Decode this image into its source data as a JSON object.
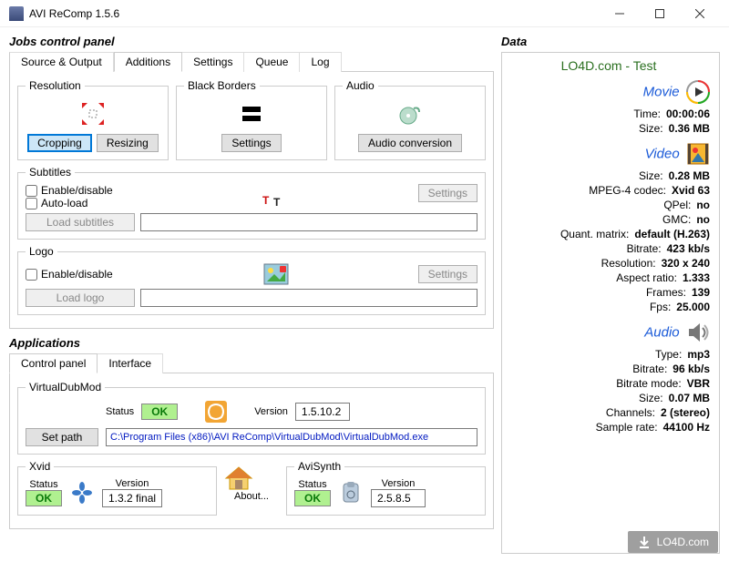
{
  "window": {
    "title": "AVI ReComp  1.5.6"
  },
  "jobs": {
    "heading": "Jobs control panel",
    "tabs": [
      "Source & Output",
      "Additions",
      "Settings",
      "Queue",
      "Log"
    ],
    "activeTab": "Additions",
    "resolution": {
      "legend": "Resolution",
      "cropping": "Cropping",
      "resizing": "Resizing",
      "icon": "resize-arrows-icon"
    },
    "blackBorders": {
      "legend": "Black Borders",
      "settings": "Settings",
      "icon": "black-borders-icon"
    },
    "audio": {
      "legend": "Audio",
      "audioConversion": "Audio conversion",
      "icon": "audio-disc-icon"
    },
    "subtitles": {
      "legend": "Subtitles",
      "enable": "Enable/disable",
      "autoload": "Auto-load",
      "load": "Load subtitles",
      "settings": "Settings",
      "icon": "font-icon"
    },
    "logo": {
      "legend": "Logo",
      "enable": "Enable/disable",
      "load": "Load logo",
      "settings": "Settings",
      "icon": "picture-icon"
    }
  },
  "apps": {
    "heading": "Applications",
    "tabs": [
      "Control panel",
      "Interface"
    ],
    "activeTab": "Control panel",
    "vdm": {
      "legend": "VirtualDubMod",
      "statusLabel": "Status",
      "status": "OK",
      "versionLabel": "Version",
      "version": "1.5.10.2",
      "setPath": "Set path",
      "path": "C:\\Program Files (x86)\\AVI ReComp\\VirtualDubMod\\VirtualDubMod.exe",
      "icon": "vdm-icon"
    },
    "xvid": {
      "legend": "Xvid",
      "statusLabel": "Status",
      "status": "OK",
      "versionLabel": "Version",
      "version": "1.3.2 final",
      "icon": "xvid-icon"
    },
    "about": {
      "label": "About...",
      "icon": "house-icon"
    },
    "avisynth": {
      "legend": "AviSynth",
      "statusLabel": "Status",
      "status": "OK",
      "versionLabel": "Version",
      "version": "2.5.8.5",
      "icon": "avisynth-icon"
    }
  },
  "data": {
    "heading": "Data",
    "title": "LO4D.com - Test",
    "movie": {
      "label": "Movie",
      "rows": [
        {
          "k": "Time:",
          "v": "00:00:06"
        },
        {
          "k": "Size:",
          "v": "0.36 MB"
        }
      ]
    },
    "video": {
      "label": "Video",
      "rows": [
        {
          "k": "Size:",
          "v": "0.28 MB"
        },
        {
          "k": "MPEG-4 codec:",
          "v": "Xvid 63"
        },
        {
          "k": "QPel:",
          "v": "no"
        },
        {
          "k": "GMC:",
          "v": "no"
        },
        {
          "k": "Quant. matrix:",
          "v": "default (H.263)"
        },
        {
          "k": "Bitrate:",
          "v": "423 kb/s"
        },
        {
          "k": "Resolution:",
          "v": "320 x 240"
        },
        {
          "k": "Aspect ratio:",
          "v": "1.333"
        },
        {
          "k": "Frames:",
          "v": "139"
        },
        {
          "k": "Fps:",
          "v": "25.000"
        }
      ]
    },
    "audio": {
      "label": "Audio",
      "rows": [
        {
          "k": "Type:",
          "v": "mp3"
        },
        {
          "k": "Bitrate:",
          "v": "96 kb/s"
        },
        {
          "k": "Bitrate mode:",
          "v": "VBR"
        },
        {
          "k": "Size:",
          "v": "0.07 MB"
        },
        {
          "k": "Channels:",
          "v": "2 (stereo)"
        },
        {
          "k": "Sample rate:",
          "v": "44100 Hz"
        }
      ]
    }
  },
  "watermark": "LO4D.com"
}
